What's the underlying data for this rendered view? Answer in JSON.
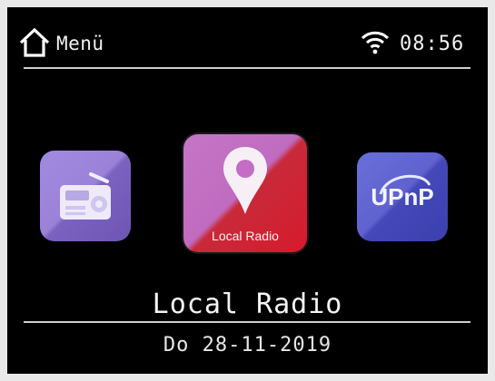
{
  "header": {
    "menu_label": "Menü",
    "home_icon": "home-icon",
    "wifi_icon": "wifi-icon",
    "time": "08:56"
  },
  "carousel": {
    "items": [
      {
        "icon": "radio-icon",
        "label": ""
      },
      {
        "icon": "map-pin-icon",
        "label": "Local Radio"
      },
      {
        "icon": "upnp-icon",
        "label": "UPnP"
      }
    ],
    "selected_label": "Local Radio"
  },
  "footer": {
    "date": "Do 28-11-2019"
  },
  "colors": {
    "background": "#000000",
    "radio_tile": "#9b82d8",
    "local_tile_top": "#c06bbf",
    "local_tile_bottom": "#d71a2c",
    "upnp_tile": "#5f62cf"
  }
}
